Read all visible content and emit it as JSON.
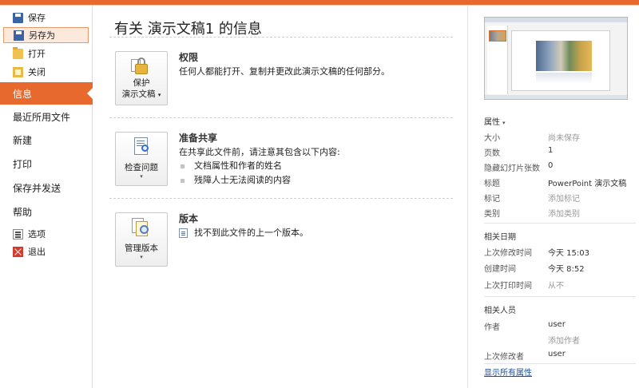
{
  "nav": {
    "small_top": [
      {
        "label": "保存",
        "icon": "save-icon"
      },
      {
        "label": "另存为",
        "icon": "save-as-icon"
      },
      {
        "label": "打开",
        "icon": "open-folder-icon"
      },
      {
        "label": "关闭",
        "icon": "close-folder-icon"
      }
    ],
    "big": [
      {
        "label": "信息",
        "active": true
      },
      {
        "label": "最近所用文件"
      },
      {
        "label": "新建"
      },
      {
        "label": "打印"
      },
      {
        "label": "保存并发送"
      },
      {
        "label": "帮助"
      }
    ],
    "small_bottom": [
      {
        "label": "选项",
        "icon": "options-icon"
      },
      {
        "label": "退出",
        "icon": "exit-icon"
      }
    ]
  },
  "main": {
    "title": "有关 演示文稿1 的信息",
    "permissions": {
      "tile_line1": "保护",
      "tile_line2": "演示文稿",
      "title": "权限",
      "desc": "任何人都能打开、复制并更改此演示文稿的任何部分。"
    },
    "share": {
      "tile_label": "检查问题",
      "title": "准备共享",
      "desc": "在共享此文件前，请注意其包含以下内容:",
      "bullets": [
        "文档属性和作者的姓名",
        "残障人士无法阅读的内容"
      ]
    },
    "versions": {
      "tile_label": "管理版本",
      "title": "版本",
      "desc": "找不到此文件的上一个版本。"
    }
  },
  "right": {
    "props_header": "属性",
    "props": [
      {
        "k": "大小",
        "v": "尚未保存",
        "muted": true
      },
      {
        "k": "页数",
        "v": "1"
      },
      {
        "k": "隐藏幻灯片张数",
        "v": "0"
      },
      {
        "k": "标题",
        "v": "PowerPoint 演示文稿"
      },
      {
        "k": "标记",
        "v": "添加标记",
        "muted": true
      },
      {
        "k": "类别",
        "v": "添加类别",
        "muted": true
      }
    ],
    "dates_header": "相关日期",
    "dates": [
      {
        "k": "上次修改时间",
        "v": "今天 15:03"
      },
      {
        "k": "创建时间",
        "v": "今天 8:52"
      },
      {
        "k": "上次打印时间",
        "v": "从不",
        "muted": true
      }
    ],
    "people_header": "相关人员",
    "people": [
      {
        "k": "作者",
        "v": "user"
      },
      {
        "k": "",
        "v": "添加作者",
        "muted": true
      },
      {
        "k": "上次修改者",
        "v": "user"
      }
    ],
    "show_all": "显示所有属性"
  },
  "colors": {
    "accent": "#e8692d",
    "link": "#1d4f9c"
  }
}
